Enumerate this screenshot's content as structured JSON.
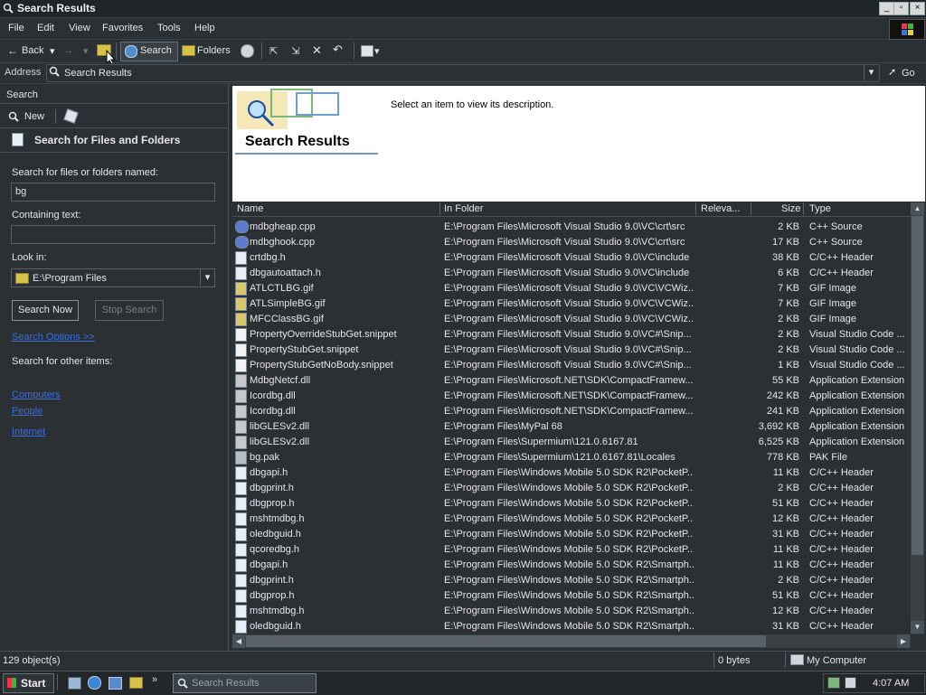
{
  "window": {
    "title": "Search Results"
  },
  "menu": [
    "File",
    "Edit",
    "View",
    "Favorites",
    "Tools",
    "Help"
  ],
  "toolbar": {
    "back": "Back",
    "search": "Search",
    "folders": "Folders"
  },
  "address": {
    "label": "Address",
    "value": "Search Results",
    "go": "Go"
  },
  "left": {
    "panel_title": "Search",
    "new_label": "New",
    "heading": "Search for Files and Folders",
    "named_label": "Search for files or folders named:",
    "named_value": "bg",
    "containing_label": "Containing text:",
    "containing_value": "",
    "lookin_label": "Look in:",
    "lookin_value": "E:\\Program Files",
    "search_now": "Search Now",
    "stop_search": "Stop Search",
    "options_link": "Search Options >>",
    "other_label": "Search for other items:",
    "other_links": [
      "Computers",
      "People",
      "Internet"
    ]
  },
  "header": {
    "title": "Search Results",
    "desc": "Select an item to view its description."
  },
  "columns": [
    "Name",
    "In Folder",
    "Releva...",
    "Size",
    "Type"
  ],
  "files": [
    {
      "name": "mdbgheap.cpp",
      "folder": "E:\\Program Files\\Microsoft Visual Studio 9.0\\VC\\crt\\src",
      "size": "2 KB",
      "type": "C++ Source",
      "icon": "cpp"
    },
    {
      "name": "mdbghook.cpp",
      "folder": "E:\\Program Files\\Microsoft Visual Studio 9.0\\VC\\crt\\src",
      "size": "17 KB",
      "type": "C++ Source",
      "icon": "cpp"
    },
    {
      "name": "crtdbg.h",
      "folder": "E:\\Program Files\\Microsoft Visual Studio 9.0\\VC\\include",
      "size": "38 KB",
      "type": "C/C++ Header",
      "icon": "h"
    },
    {
      "name": "dbgautoattach.h",
      "folder": "E:\\Program Files\\Microsoft Visual Studio 9.0\\VC\\include",
      "size": "6 KB",
      "type": "C/C++ Header",
      "icon": "h"
    },
    {
      "name": "ATLCTLBG.gif",
      "folder": "E:\\Program Files\\Microsoft Visual Studio 9.0\\VC\\VCWiz...",
      "size": "7 KB",
      "type": "GIF Image",
      "icon": "gif"
    },
    {
      "name": "ATLSimpleBG.gif",
      "folder": "E:\\Program Files\\Microsoft Visual Studio 9.0\\VC\\VCWiz...",
      "size": "7 KB",
      "type": "GIF Image",
      "icon": "gif"
    },
    {
      "name": "MFCClassBG.gif",
      "folder": "E:\\Program Files\\Microsoft Visual Studio 9.0\\VC\\VCWiz...",
      "size": "2 KB",
      "type": "GIF Image",
      "icon": "gif"
    },
    {
      "name": "PropertyOverrideStubGet.snippet",
      "folder": "E:\\Program Files\\Microsoft Visual Studio 9.0\\VC#\\Snip...",
      "size": "2 KB",
      "type": "Visual Studio Code ...",
      "icon": "snip"
    },
    {
      "name": "PropertyStubGet.snippet",
      "folder": "E:\\Program Files\\Microsoft Visual Studio 9.0\\VC#\\Snip...",
      "size": "2 KB",
      "type": "Visual Studio Code ...",
      "icon": "snip"
    },
    {
      "name": "PropertyStubGetNoBody.snippet",
      "folder": "E:\\Program Files\\Microsoft Visual Studio 9.0\\VC#\\Snip...",
      "size": "1 KB",
      "type": "Visual Studio Code ...",
      "icon": "snip"
    },
    {
      "name": "MdbgNetcf.dll",
      "folder": "E:\\Program Files\\Microsoft.NET\\SDK\\CompactFramew...",
      "size": "55 KB",
      "type": "Application Extension",
      "icon": "dll"
    },
    {
      "name": "Icordbg.dll",
      "folder": "E:\\Program Files\\Microsoft.NET\\SDK\\CompactFramew...",
      "size": "242 KB",
      "type": "Application Extension",
      "icon": "dll"
    },
    {
      "name": "Icordbg.dll",
      "folder": "E:\\Program Files\\Microsoft.NET\\SDK\\CompactFramew...",
      "size": "241 KB",
      "type": "Application Extension",
      "icon": "dll"
    },
    {
      "name": "libGLESv2.dll",
      "folder": "E:\\Program Files\\MyPal 68",
      "size": "3,692 KB",
      "type": "Application Extension",
      "icon": "dll"
    },
    {
      "name": "libGLESv2.dll",
      "folder": "E:\\Program Files\\Supermium\\121.0.6167.81",
      "size": "6,525 KB",
      "type": "Application Extension",
      "icon": "dll"
    },
    {
      "name": "bg.pak",
      "folder": "E:\\Program Files\\Supermium\\121.0.6167.81\\Locales",
      "size": "778 KB",
      "type": "PAK File",
      "icon": "pak"
    },
    {
      "name": "dbgapi.h",
      "folder": "E:\\Program Files\\Windows Mobile 5.0 SDK R2\\PocketP...",
      "size": "11 KB",
      "type": "C/C++ Header",
      "icon": "h"
    },
    {
      "name": "dbgprint.h",
      "folder": "E:\\Program Files\\Windows Mobile 5.0 SDK R2\\PocketP...",
      "size": "2 KB",
      "type": "C/C++ Header",
      "icon": "h"
    },
    {
      "name": "dbgprop.h",
      "folder": "E:\\Program Files\\Windows Mobile 5.0 SDK R2\\PocketP...",
      "size": "51 KB",
      "type": "C/C++ Header",
      "icon": "h"
    },
    {
      "name": "mshtmdbg.h",
      "folder": "E:\\Program Files\\Windows Mobile 5.0 SDK R2\\PocketP...",
      "size": "12 KB",
      "type": "C/C++ Header",
      "icon": "h"
    },
    {
      "name": "oledbguid.h",
      "folder": "E:\\Program Files\\Windows Mobile 5.0 SDK R2\\PocketP...",
      "size": "31 KB",
      "type": "C/C++ Header",
      "icon": "h"
    },
    {
      "name": "qcoredbg.h",
      "folder": "E:\\Program Files\\Windows Mobile 5.0 SDK R2\\PocketP...",
      "size": "11 KB",
      "type": "C/C++ Header",
      "icon": "h"
    },
    {
      "name": "dbgapi.h",
      "folder": "E:\\Program Files\\Windows Mobile 5.0 SDK R2\\Smartph...",
      "size": "11 KB",
      "type": "C/C++ Header",
      "icon": "h"
    },
    {
      "name": "dbgprint.h",
      "folder": "E:\\Program Files\\Windows Mobile 5.0 SDK R2\\Smartph...",
      "size": "2 KB",
      "type": "C/C++ Header",
      "icon": "h"
    },
    {
      "name": "dbgprop.h",
      "folder": "E:\\Program Files\\Windows Mobile 5.0 SDK R2\\Smartph...",
      "size": "51 KB",
      "type": "C/C++ Header",
      "icon": "h"
    },
    {
      "name": "mshtmdbg.h",
      "folder": "E:\\Program Files\\Windows Mobile 5.0 SDK R2\\Smartph...",
      "size": "12 KB",
      "type": "C/C++ Header",
      "icon": "h"
    },
    {
      "name": "oledbguid.h",
      "folder": "E:\\Program Files\\Windows Mobile 5.0 SDK R2\\Smartph...",
      "size": "31 KB",
      "type": "C/C++ Header",
      "icon": "h"
    }
  ],
  "status": {
    "count": "129 object(s)",
    "bytes": "0 bytes",
    "zone": "My Computer"
  },
  "taskbar": {
    "start": "Start",
    "task": "Search Results",
    "time": "4:07 AM"
  },
  "colors": {
    "bg": "#2b3034",
    "link": "#3b6fe0",
    "header_bg": "#ffffff"
  }
}
